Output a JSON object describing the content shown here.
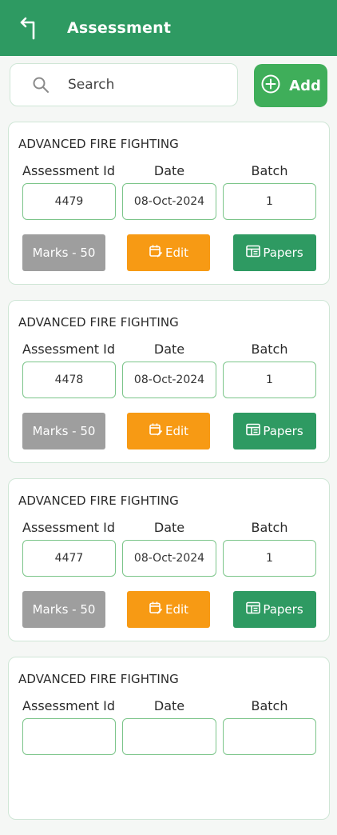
{
  "header": {
    "title": "Assessment",
    "back_icon": "back-arrow-icon"
  },
  "search": {
    "placeholder": "Search",
    "value": ""
  },
  "add_button": {
    "label": "Add"
  },
  "columns": {
    "id": "Assessment Id",
    "date": "Date",
    "batch": "Batch"
  },
  "assessments": [
    {
      "course": "ADVANCED FIRE FIGHTING",
      "id": "4479",
      "date": "08-Oct-2024",
      "batch": "1",
      "marks": "Marks - 50",
      "edit": "Edit",
      "papers": "Papers"
    },
    {
      "course": "ADVANCED FIRE FIGHTING",
      "id": "4478",
      "date": "08-Oct-2024",
      "batch": "1",
      "marks": "Marks - 50",
      "edit": "Edit",
      "papers": "Papers"
    },
    {
      "course": "ADVANCED FIRE FIGHTING",
      "id": "4477",
      "date": "08-Oct-2024",
      "batch": "1",
      "marks": "Marks - 50",
      "edit": "Edit",
      "papers": "Papers"
    },
    {
      "course": "ADVANCED FIRE FIGHTING"
    }
  ],
  "colors": {
    "primary": "#2e9a62",
    "add": "#3fae5a",
    "edit": "#f79a14",
    "marks": "#9e9e9e",
    "border": "#7cc58a"
  }
}
